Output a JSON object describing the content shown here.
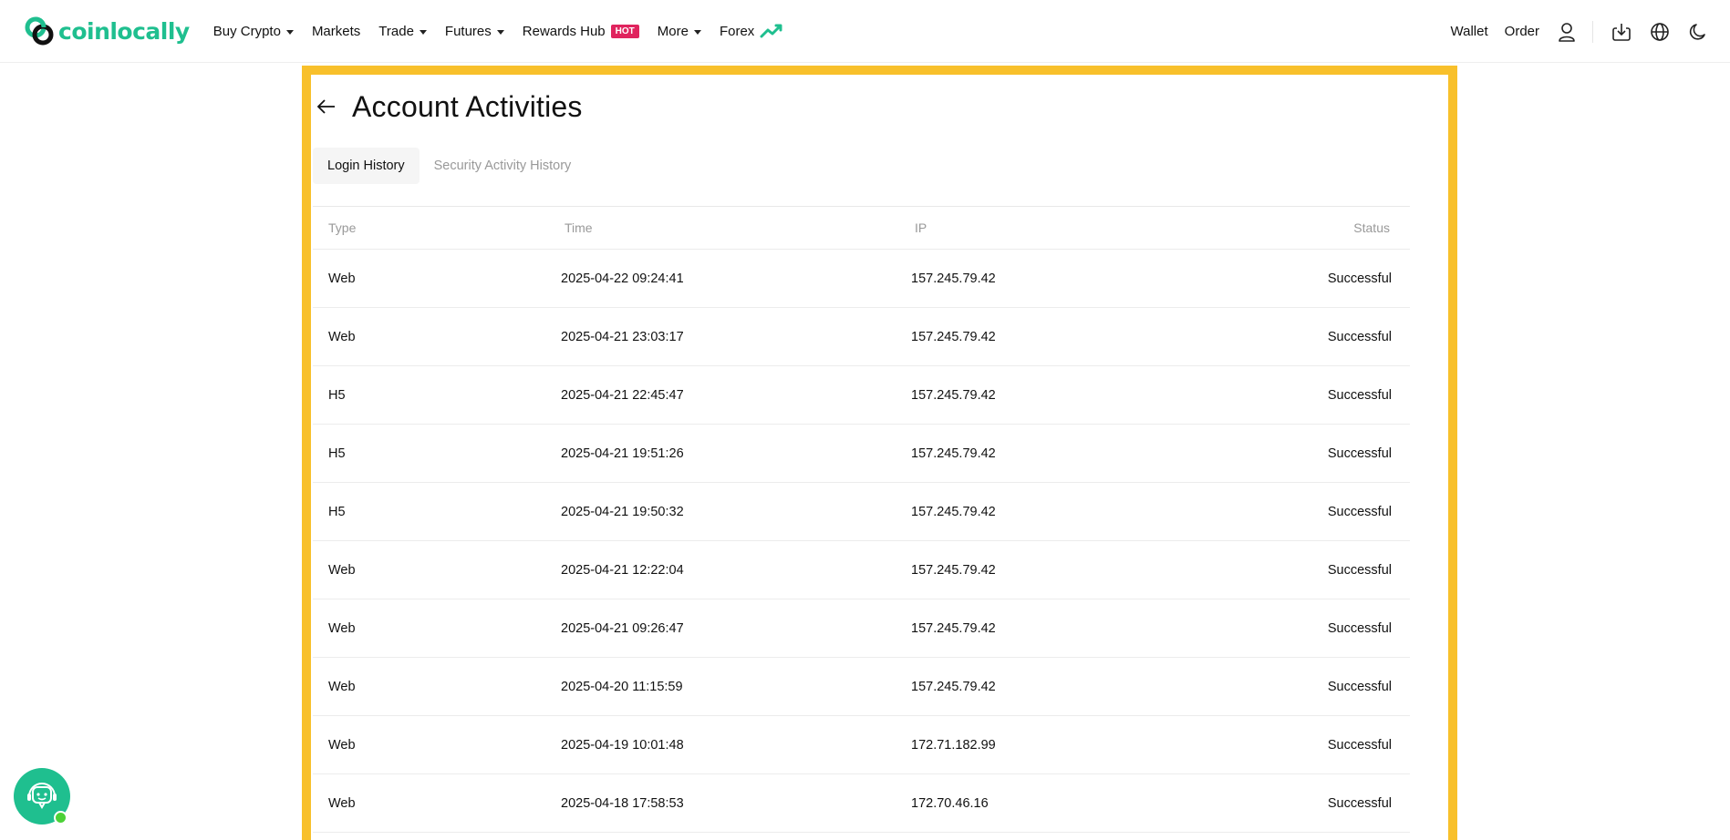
{
  "brand": {
    "name": "coinlocally",
    "color": "#1fbf8f"
  },
  "nav": {
    "buy_crypto": "Buy Crypto",
    "markets": "Markets",
    "trade": "Trade",
    "futures": "Futures",
    "rewards_hub": "Rewards Hub",
    "hot_badge": "HOT",
    "more": "More",
    "forex": "Forex"
  },
  "header_right": {
    "wallet": "Wallet",
    "order": "Order",
    "icons": [
      "user-icon",
      "download-icon",
      "globe-icon",
      "moon-icon"
    ]
  },
  "page": {
    "title": "Account Activities",
    "highlight_color": "#f8c02b"
  },
  "tabs": [
    {
      "label": "Login History",
      "active": true
    },
    {
      "label": "Security Activity History",
      "active": false
    }
  ],
  "table": {
    "headers": {
      "type": "Type",
      "time": "Time",
      "ip": "IP",
      "status": "Status"
    },
    "rows": [
      {
        "type": "Web",
        "time": "2025-04-22 09:24:41",
        "ip": "157.245.79.42",
        "status": "Successful"
      },
      {
        "type": "Web",
        "time": "2025-04-21 23:03:17",
        "ip": "157.245.79.42",
        "status": "Successful"
      },
      {
        "type": "H5",
        "time": "2025-04-21 22:45:47",
        "ip": "157.245.79.42",
        "status": "Successful"
      },
      {
        "type": "H5",
        "time": "2025-04-21 19:51:26",
        "ip": "157.245.79.42",
        "status": "Successful"
      },
      {
        "type": "H5",
        "time": "2025-04-21 19:50:32",
        "ip": "157.245.79.42",
        "status": "Successful"
      },
      {
        "type": "Web",
        "time": "2025-04-21 12:22:04",
        "ip": "157.245.79.42",
        "status": "Successful"
      },
      {
        "type": "Web",
        "time": "2025-04-21 09:26:47",
        "ip": "157.245.79.42",
        "status": "Successful"
      },
      {
        "type": "Web",
        "time": "2025-04-20 11:15:59",
        "ip": "157.245.79.42",
        "status": "Successful"
      },
      {
        "type": "Web",
        "time": "2025-04-19 10:01:48",
        "ip": "172.71.182.99",
        "status": "Successful"
      },
      {
        "type": "Web",
        "time": "2025-04-18 17:58:53",
        "ip": "172.70.46.16",
        "status": "Successful"
      }
    ]
  },
  "support": {
    "icon": "support-agent-icon",
    "online_color": "#4cd137"
  }
}
